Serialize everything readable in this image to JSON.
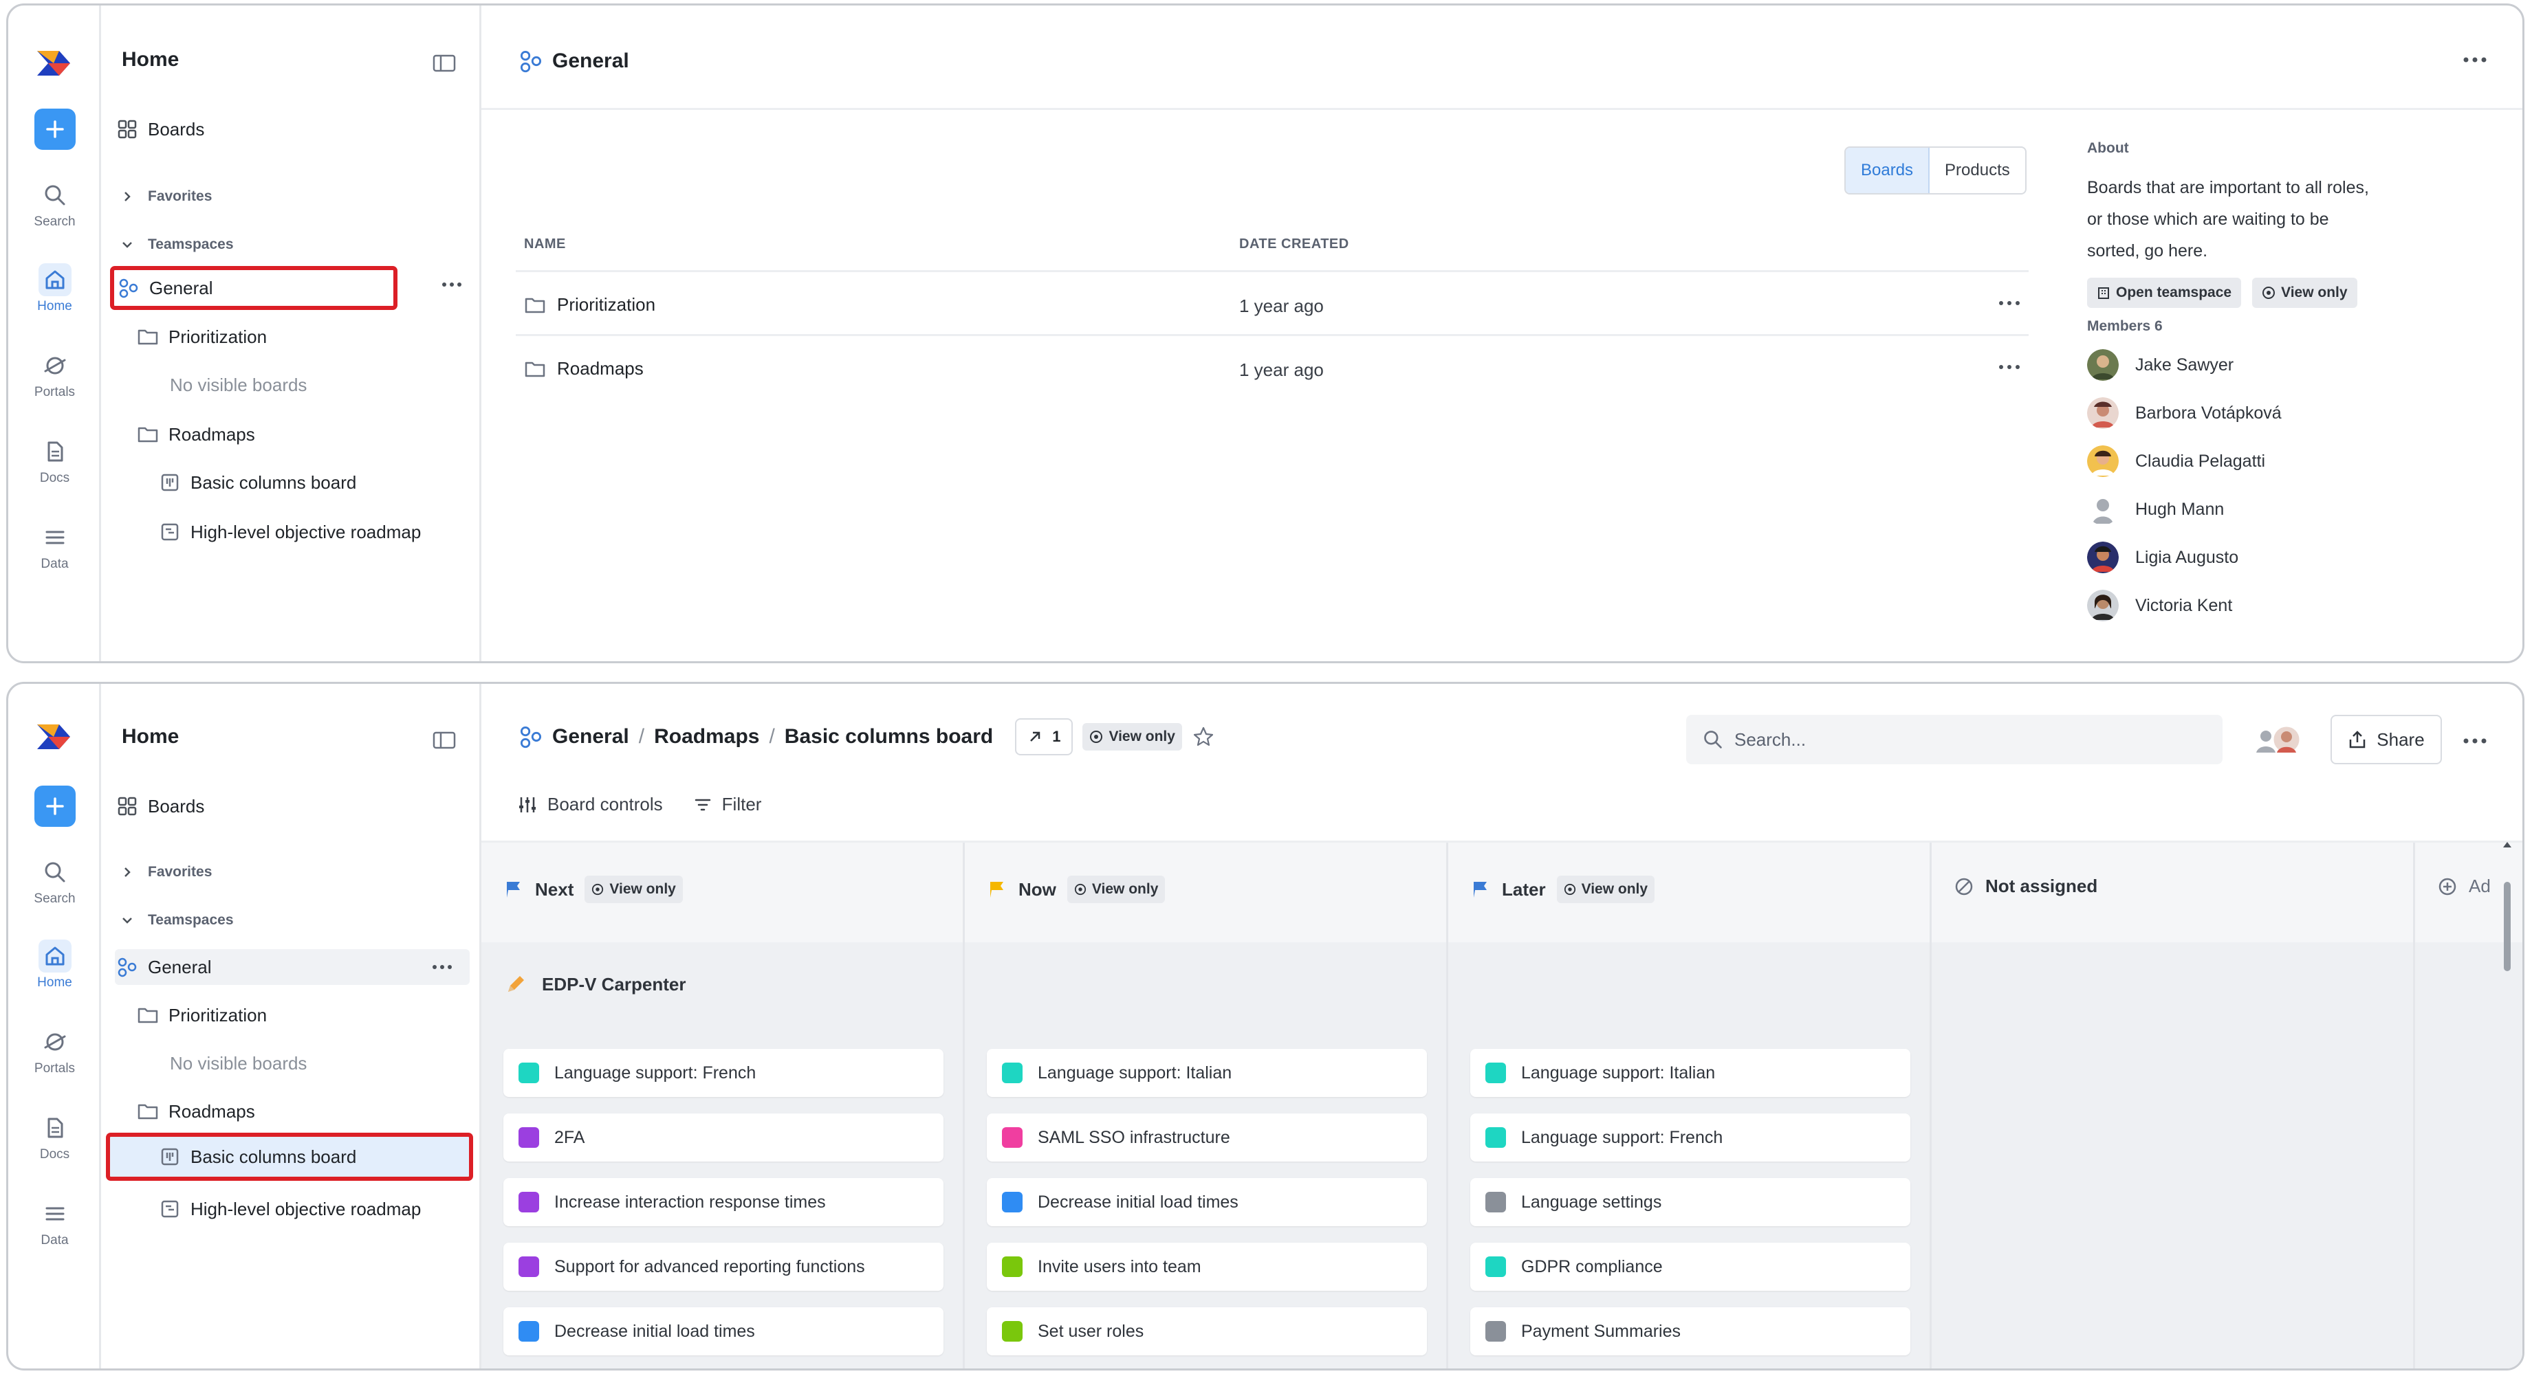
{
  "rail": {
    "items": [
      {
        "label": "Search",
        "icon": "search-icon"
      },
      {
        "label": "Home",
        "icon": "home-icon",
        "active": true
      },
      {
        "label": "Portals",
        "icon": "portals-icon"
      },
      {
        "label": "Docs",
        "icon": "docs-icon"
      },
      {
        "label": "Data",
        "icon": "data-icon"
      }
    ]
  },
  "sidebar": {
    "title": "Home",
    "boards": "Boards",
    "favorites": "Favorites",
    "teamspaces": "Teamspaces",
    "general": "General",
    "prioritization": "Prioritization",
    "no_visible": "No visible boards",
    "roadmaps": "Roadmaps",
    "basic_columns": "Basic columns board",
    "objective_roadmap": "High-level objective roadmap"
  },
  "panel1": {
    "title": "General",
    "tabs": {
      "boards": "Boards",
      "products": "Products",
      "active": "Boards"
    },
    "table": {
      "headers": {
        "name": "NAME",
        "date": "DATE CREATED"
      },
      "rows": [
        {
          "name": "Prioritization",
          "date": "1 year ago"
        },
        {
          "name": "Roadmaps",
          "date": "1 year ago"
        }
      ]
    },
    "about": {
      "heading": "About",
      "text": "Boards that are important to all roles, or those which are waiting to be sorted, go here.",
      "open_teamspace": "Open teamspace",
      "view_only": "View only"
    },
    "members": {
      "heading": "Members 6",
      "list": [
        "Jake Sawyer",
        "Barbora Votápková",
        "Claudia Pelagatti",
        "Hugh Mann",
        "Ligia Augusto",
        "Victoria Kent"
      ]
    }
  },
  "panel2": {
    "breadcrumb": [
      "General",
      "Roadmaps",
      "Basic columns board"
    ],
    "breadcrumb_sep": "/",
    "link_count": "1",
    "view_only": "View only",
    "search_placeholder": "Search...",
    "share": "Share",
    "board_controls": "Board controls",
    "filter": "Filter",
    "columns": [
      {
        "name": "Next",
        "flag": "#3a7bd5",
        "view_only": "View only"
      },
      {
        "name": "Now",
        "flag": "#f5b700",
        "view_only": "View only"
      },
      {
        "name": "Later",
        "flag": "#3a7bd5",
        "view_only": "View only"
      },
      {
        "name": "Not assigned"
      },
      {
        "name": "Ad"
      }
    ],
    "group": "EDP-V Carpenter",
    "cards": [
      [
        {
          "text": "Language support: French",
          "color": "#1ed6c2"
        },
        {
          "text": "2FA",
          "color": "#9b3fe0"
        },
        {
          "text": "Increase interaction response times",
          "color": "#9b3fe0"
        },
        {
          "text": "Support for advanced reporting functions",
          "color": "#9b3fe0"
        },
        {
          "text": "Decrease initial load times",
          "color": "#2f8cf3"
        }
      ],
      [
        {
          "text": "Language support: Italian",
          "color": "#1ed6c2"
        },
        {
          "text": "SAML SSO infrastructure",
          "color": "#f03ea0"
        },
        {
          "text": "Decrease initial load times",
          "color": "#2f8cf3"
        },
        {
          "text": "Invite users into team",
          "color": "#7ac70c"
        },
        {
          "text": "Set user roles",
          "color": "#7ac70c"
        }
      ],
      [
        {
          "text": "Language support: Italian",
          "color": "#1ed6c2"
        },
        {
          "text": "Language support: French",
          "color": "#1ed6c2"
        },
        {
          "text": "Language settings",
          "color": "#8a9099"
        },
        {
          "text": "GDPR compliance",
          "color": "#1ed6c2"
        },
        {
          "text": "Payment Summaries",
          "color": "#8a9099"
        }
      ]
    ]
  }
}
